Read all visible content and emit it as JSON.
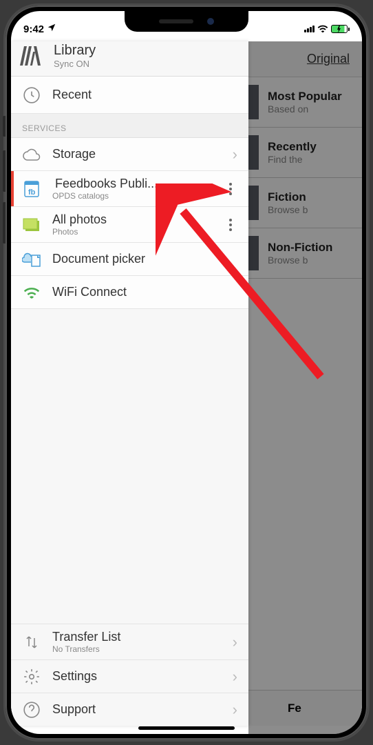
{
  "status": {
    "time": "9:42",
    "charging": true
  },
  "background": {
    "title": "Original",
    "items": [
      {
        "title": "Most Popular",
        "sub": "Based on"
      },
      {
        "title": "Recently",
        "sub": "Find the"
      },
      {
        "title": "Fiction",
        "sub": "Browse b"
      },
      {
        "title": "Non-Fiction",
        "sub": "Browse b"
      }
    ],
    "back_label": "Fe"
  },
  "drawer": {
    "title": "Library",
    "subtitle": "Sync ON",
    "recent_label": "Recent",
    "section_header": "SERVICES",
    "items": [
      {
        "label": "Storage",
        "sub": ""
      },
      {
        "label": "Feedbooks Publi...",
        "sub": "OPDS catalogs"
      },
      {
        "label": "All photos",
        "sub": "Photos"
      },
      {
        "label": "Document picker",
        "sub": ""
      },
      {
        "label": "WiFi Connect",
        "sub": ""
      }
    ],
    "bottom": [
      {
        "label": "Transfer List",
        "sub": "No Transfers"
      },
      {
        "label": "Settings",
        "sub": ""
      },
      {
        "label": "Support",
        "sub": ""
      }
    ]
  }
}
